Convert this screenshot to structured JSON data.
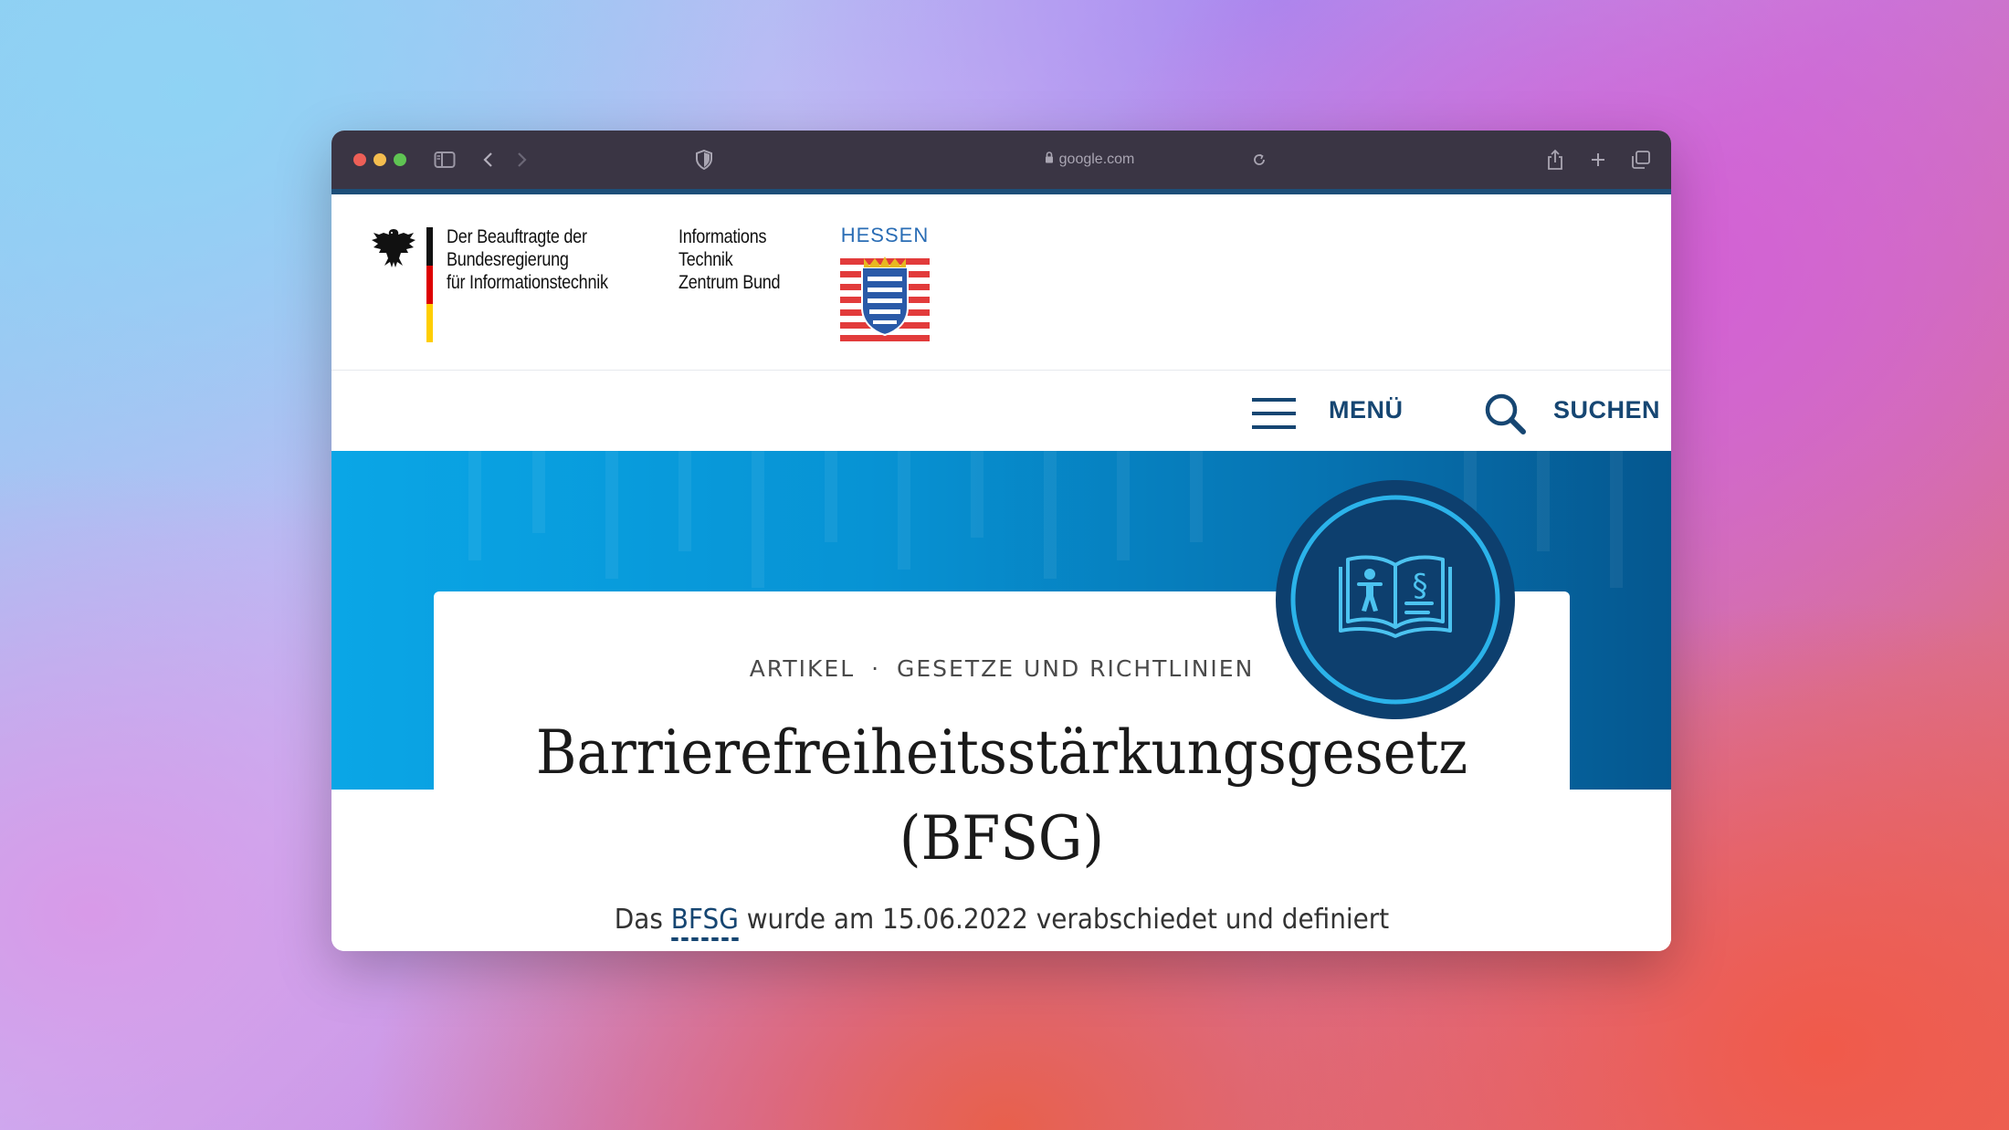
{
  "browser": {
    "url": "google.com",
    "colors": {
      "toolbar": "#3a3544",
      "close": "#ed5f57",
      "minimize": "#f4bd4f",
      "maximize": "#5fc453"
    }
  },
  "header": {
    "bund_logo_text": "Der Beauftragte der\nBundesregierung\nfür Informationstechnik",
    "itz_logo_text": "Informations\nTechnik\nZentrum Bund",
    "hessen_label": "HESSEN"
  },
  "nav": {
    "menu_label": "MENÜ",
    "search_label": "SUCHEN",
    "accent_color": "#164672"
  },
  "article": {
    "kicker_type": "ARTIKEL",
    "kicker_sep": "·",
    "kicker_category": "GESETZE UND RICHTLINIEN",
    "title_line1": "Barrierefreiheitsstärkungsgesetz",
    "title_line2": "(BFSG)",
    "lead_prefix": "Das",
    "lead_abbr": "BFSG",
    "lead_suffix": "wurde am 15.06.2022 verabschiedet und definiert"
  },
  "badge_icon": "accessibility-law-book-icon"
}
